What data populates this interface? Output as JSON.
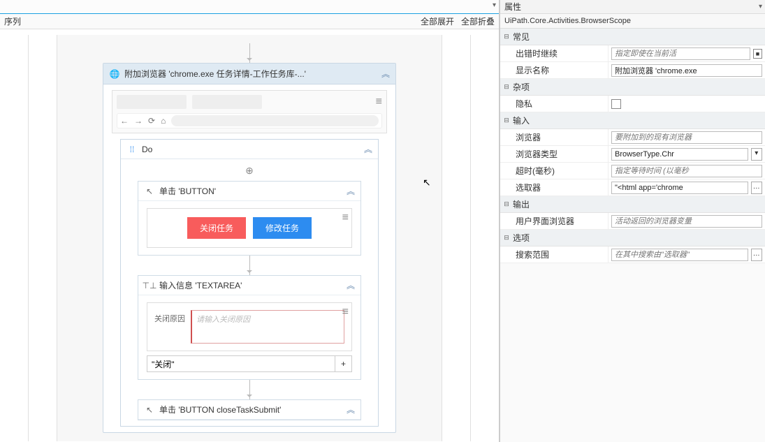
{
  "leftPanel": {
    "title": "序列",
    "actions": {
      "expandAll": "全部展开",
      "collapseAll": "全部折叠"
    }
  },
  "workflow": {
    "attachBrowser": {
      "title": "附加浏览器 'chrome.exe 任务详情-工作任务库-...'"
    },
    "do": {
      "title": "Do"
    },
    "clickButton": {
      "title": "单击 'BUTTON'",
      "redBtn": "关闭任务",
      "blueBtn": "修改任务"
    },
    "typeInto": {
      "title": "输入信息 'TEXTAREA'",
      "fieldLabel": "关闭原因",
      "placeholder": "请输入关闭原因",
      "value": "\"关闭\""
    },
    "clickSubmit": {
      "title": "单击 'BUTTON  closeTaskSubmit'"
    }
  },
  "propsPanel": {
    "title": "属性",
    "subtitle": "UiPath.Core.Activities.BrowserScope",
    "cats": {
      "common": "常见",
      "misc": "杂项",
      "input": "输入",
      "output": "输出",
      "options": "选项"
    },
    "rows": {
      "continueOnError": {
        "label": "出错时继续",
        "placeholder": "指定即使在当前活"
      },
      "displayName": {
        "label": "显示名称",
        "value": "附加浏览器 'chrome.exe"
      },
      "private": {
        "label": "隐私"
      },
      "browser": {
        "label": "浏览器",
        "placeholder": "要附加到的现有浏览器"
      },
      "browserType": {
        "label": "浏览器类型",
        "value": "BrowserType.Chr"
      },
      "timeout": {
        "label": "超时(毫秒)",
        "placeholder": "指定等待时间 (以毫秒"
      },
      "selector": {
        "label": "选取器",
        "value": "\"<html app='chrome"
      },
      "uiBrowser": {
        "label": "用户界面浏览器",
        "placeholder": "活动返回的浏览器变量"
      },
      "searchScope": {
        "label": "搜索范围",
        "placeholder": "在其中搜索由\"选取器\""
      }
    }
  }
}
